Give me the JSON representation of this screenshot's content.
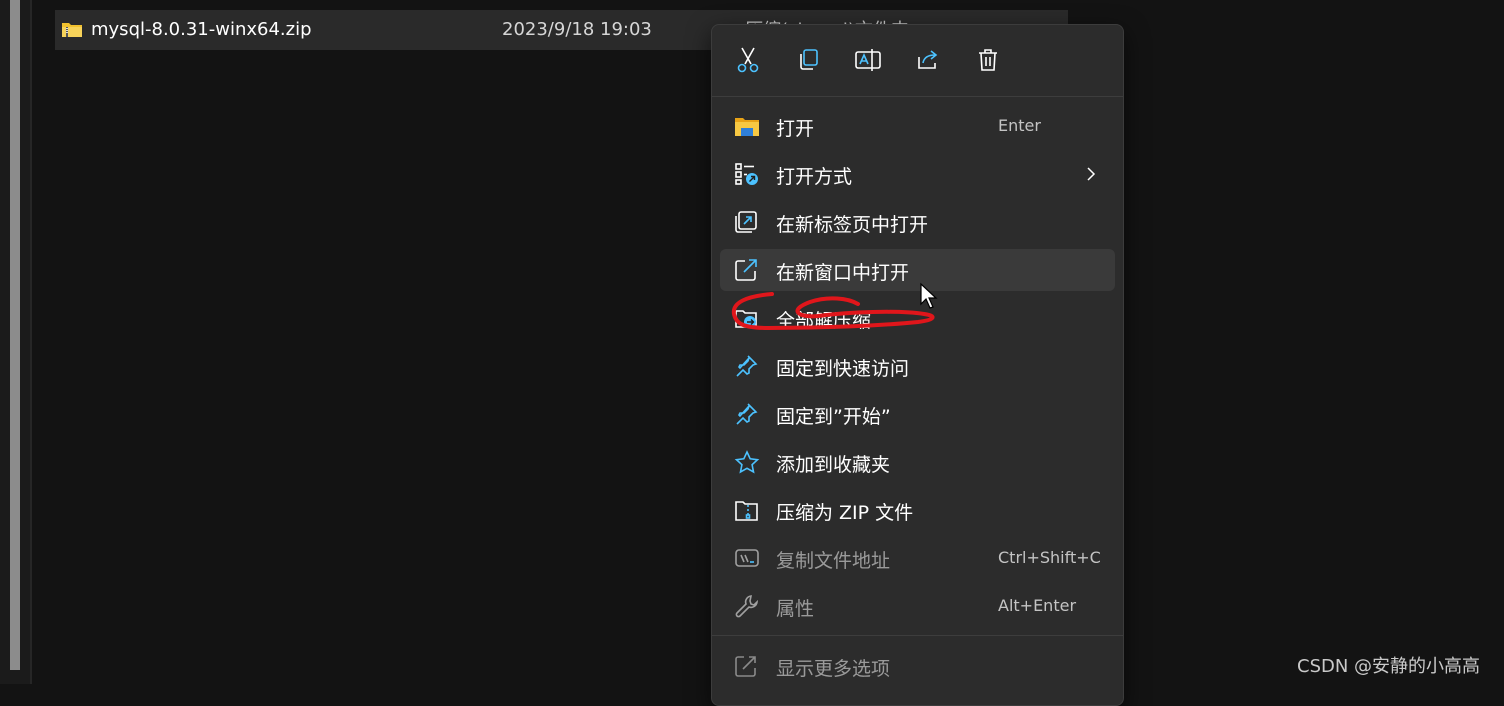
{
  "file": {
    "name": "mysql-8.0.31-winx64.zip",
    "modified": "2023/9/18 19:03",
    "type_partial": "压缩(zipped)文件夹"
  },
  "toolbar": {
    "cut_icon": "scissors-icon",
    "copy_icon": "copy-icon",
    "rename_icon": "rename-icon",
    "share_icon": "share-icon",
    "delete_icon": "trash-icon"
  },
  "menu": {
    "items": [
      {
        "label": "打开",
        "shortcut": "Enter",
        "icon": "folder-icon"
      },
      {
        "label": "打开方式",
        "icon": "open-with-icon"
      },
      {
        "label": "在新标签页中打开",
        "icon": "new-tab-icon"
      },
      {
        "label": "在新窗口中打开",
        "icon": "new-window-icon"
      },
      {
        "label": "全部解压缩",
        "icon": "extract-all-icon"
      },
      {
        "label": "固定到快速访问",
        "icon": "pin-icon"
      },
      {
        "label": "固定到”开始”",
        "icon": "pin-icon"
      },
      {
        "label": "添加到收藏夹",
        "icon": "star-icon"
      },
      {
        "label": "压缩为 ZIP 文件",
        "icon": "zip-icon"
      },
      {
        "label": "复制文件地址",
        "shortcut": "Ctrl+Shift+C",
        "icon": "copy-path-icon"
      },
      {
        "label": "属性",
        "shortcut": "Alt+Enter",
        "icon": "wrench-icon"
      },
      {
        "label": "显示更多选项",
        "icon": "more-options-icon"
      }
    ]
  },
  "watermark": "CSDN @安静的小高高",
  "colors": {
    "background": "#131313",
    "menu_bg": "#2c2c2c",
    "accent": "#4cc2ff",
    "annotation": "#e0161b",
    "folder": "#f2c12e"
  }
}
